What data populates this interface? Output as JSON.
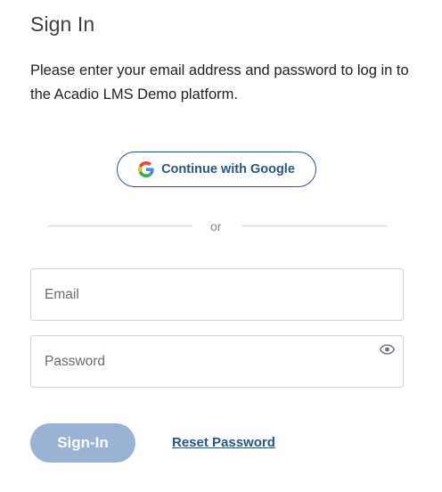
{
  "form": {
    "title": "Sign In",
    "intro": "Please enter your email address and password to log in to the Acadio LMS Demo platform."
  },
  "google_button": {
    "label": "Continue with Google",
    "icon": "google-g-icon"
  },
  "divider": {
    "text": "or"
  },
  "email_field": {
    "value": "",
    "placeholder": "Email"
  },
  "password_field": {
    "value": "",
    "placeholder": "Password",
    "toggle_icon": "eye-icon"
  },
  "actions": {
    "signin_label": "Sign-In",
    "reset_label": "Reset Password"
  },
  "colors": {
    "primary": "#2a5580",
    "signin_disabled_bg": "#9ab3d5",
    "border": "#ced4da"
  }
}
